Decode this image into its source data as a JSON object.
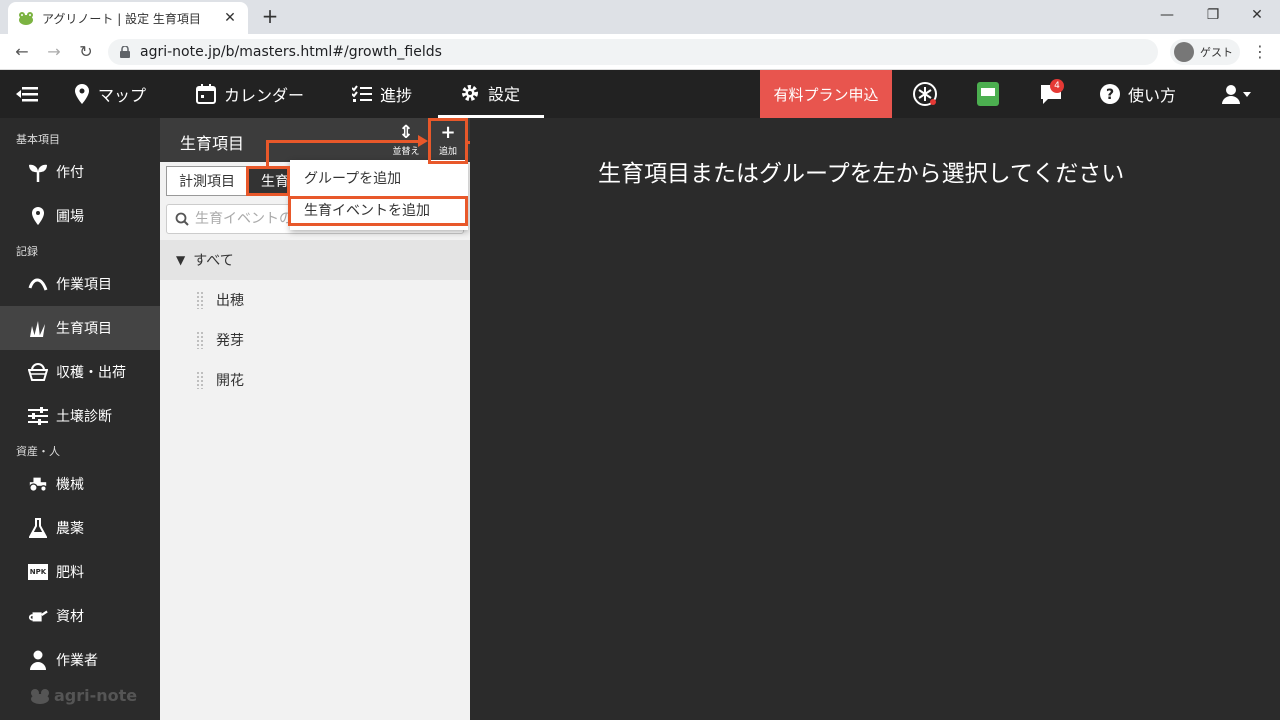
{
  "browser": {
    "tab_title": "アグリノート | 設定 生育項目",
    "url": "agri-note.jp/b/masters.html#/growth_fields",
    "profile_label": "ゲスト"
  },
  "header": {
    "nav": [
      {
        "label": "マップ",
        "icon": "map-pin-icon"
      },
      {
        "label": "カレンダー",
        "icon": "calendar-icon"
      },
      {
        "label": "進捗",
        "icon": "checklist-icon"
      },
      {
        "label": "設定",
        "icon": "gear-icon"
      }
    ],
    "active": "設定",
    "paid_plan": "有料プラン申込",
    "notification_count": "4",
    "help_label": "使い方",
    "accent_color": "#e8554e"
  },
  "sidebar": {
    "sections": [
      {
        "title": "基本項目",
        "items": [
          "作付",
          "圃場"
        ]
      },
      {
        "title": "記録",
        "items": [
          "作業項目",
          "生育項目",
          "収穫・出荷",
          "土壌診断"
        ]
      },
      {
        "title": "資産・人",
        "items": [
          "機械",
          "農薬",
          "肥料",
          "資材",
          "作業者"
        ]
      }
    ],
    "active_item": "生育項目",
    "brand": "agri-note",
    "npk_label": "NPK"
  },
  "panel": {
    "title": "生育項目",
    "sort_label": "並替え",
    "add_label": "追加",
    "tabs": [
      "計測項目",
      "生育"
    ],
    "search_placeholder": "生育イベントの",
    "group": "すべて",
    "events": [
      "出穂",
      "発芽",
      "開花"
    ]
  },
  "dropdown": {
    "items": [
      "グループを追加",
      "生育イベントを追加"
    ]
  },
  "main": {
    "message": "生育項目またはグループを左から選択してください"
  },
  "highlight_color": "#e8582a"
}
